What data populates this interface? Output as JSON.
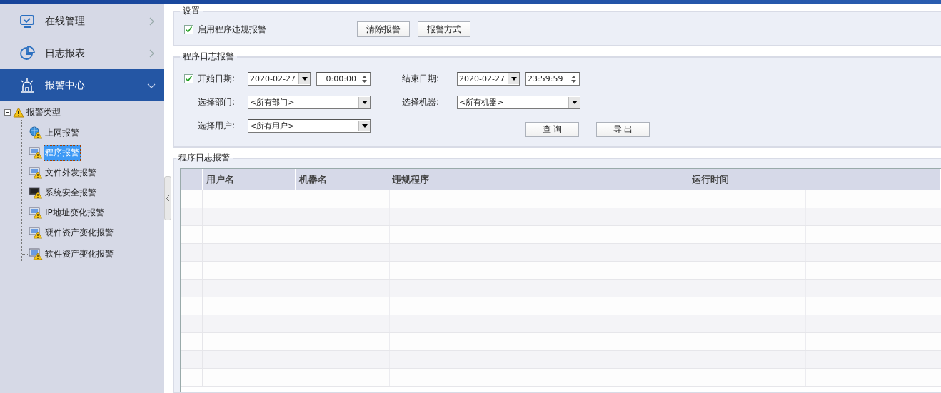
{
  "sidebar": {
    "nav_items": [
      {
        "label": "在线管理",
        "selected": false,
        "expanded": false
      },
      {
        "label": "日志报表",
        "selected": false,
        "expanded": false
      },
      {
        "label": "报警中心",
        "selected": true,
        "expanded": true
      }
    ],
    "tree": {
      "label": "报警类型",
      "expanded": true,
      "children": [
        {
          "label": "上网报警",
          "selected": false
        },
        {
          "label": "程序报警",
          "selected": true
        },
        {
          "label": "文件外发报警",
          "selected": false
        },
        {
          "label": "系统安全报警",
          "selected": false
        },
        {
          "label": "IP地址变化报警",
          "selected": false
        },
        {
          "label": "硬件资产变化报警",
          "selected": false
        },
        {
          "label": "软件资产变化报警",
          "selected": false
        }
      ]
    }
  },
  "settings": {
    "title": "设置",
    "enable_checkbox": {
      "label": "启用程序违规报警",
      "checked": true
    },
    "buttons": [
      "清除报警",
      "报警方式"
    ]
  },
  "filter": {
    "title": "程序日志报警",
    "date_checkbox": {
      "checked": true
    },
    "start_label": "开始日期:",
    "start_date": "2020-02-27",
    "start_time": "0:00:00",
    "end_label": "结束日期:",
    "end_date": "2020-02-27",
    "end_time": "23:59:59",
    "department_label": "选择部门:",
    "department": "<所有部门>",
    "machine_label": "选择机器:",
    "machine": "<所有机器>",
    "user_label": "选择用户:",
    "user": "<所有用户>",
    "buttons": [
      "查 询",
      "导 出"
    ]
  },
  "log": {
    "title": "程序日志报警",
    "columns": [
      "用户名",
      "机器名",
      "违规程序",
      "运行时间"
    ]
  }
}
